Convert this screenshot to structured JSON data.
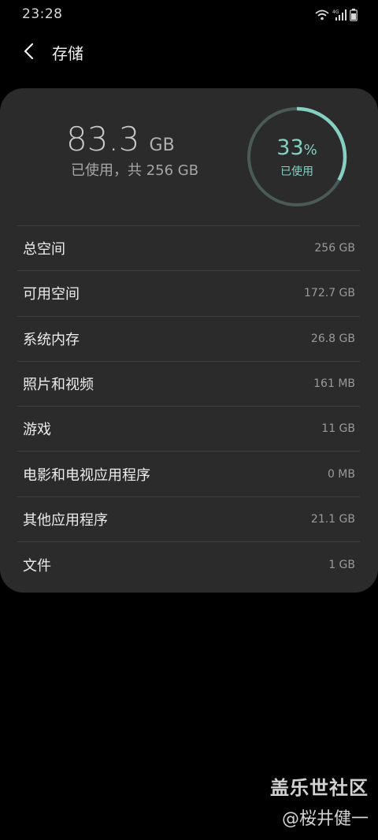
{
  "status_bar": {
    "time": "23:28",
    "icons": [
      "wifi-icon",
      "4g-signal-icon",
      "battery-icon"
    ]
  },
  "header": {
    "title": "存储",
    "back_icon": "chevron-left-icon"
  },
  "summary": {
    "used_number": "83.3",
    "used_unit": "GB",
    "caption": "已使用，共 256 GB",
    "percent_value": "33",
    "percent_sign": "%",
    "percent_label": "已使用",
    "percent_fraction": 0.33,
    "ring_color": "#86d0c3",
    "ring_track_color": "#4a5a57"
  },
  "categories": [
    {
      "label": "总空间",
      "value": "256 GB"
    },
    {
      "label": "可用空间",
      "value": "172.7 GB"
    },
    {
      "label": "系统内存",
      "value": "26.8 GB"
    },
    {
      "label": "照片和视频",
      "value": "161 MB"
    },
    {
      "label": "游戏",
      "value": "11 GB"
    },
    {
      "label": "电影和电视应用程序",
      "value": "0 MB"
    },
    {
      "label": "其他应用程序",
      "value": "21.1 GB"
    },
    {
      "label": "文件",
      "value": "1 GB"
    }
  ],
  "watermark": {
    "title": "盖乐世社区",
    "author": "@桜井健一"
  }
}
